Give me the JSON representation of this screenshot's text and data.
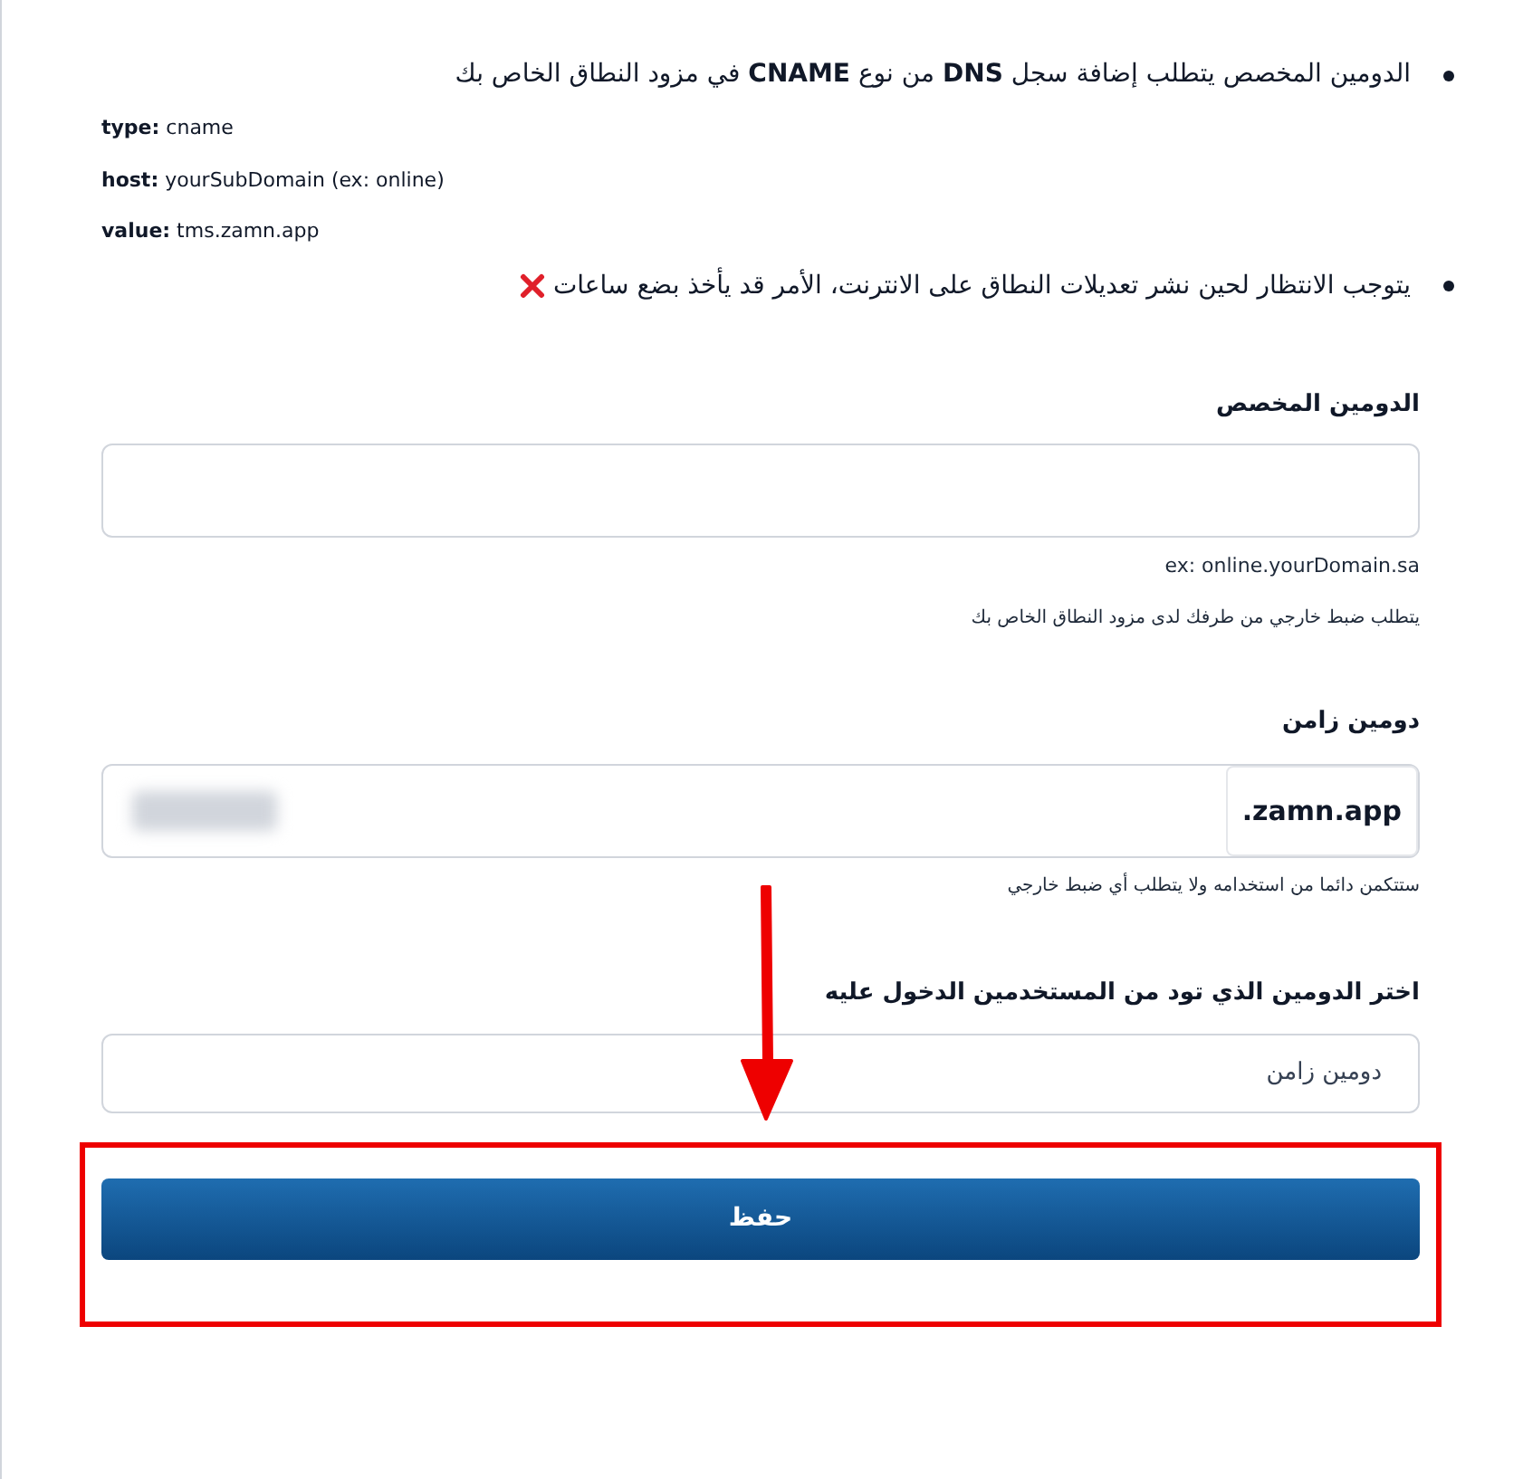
{
  "notes": [
    {
      "kind": "bullet",
      "text": "الدومين المخصص يتطلب إضافة سجل **DNS** من نوع **CNAME** في مزود النطاق الخاص بك"
    },
    {
      "kind": "record",
      "text": "**type:** cname"
    },
    {
      "kind": "record",
      "text": "**host:** yourSubDomain (ex: online)"
    },
    {
      "kind": "record",
      "text": "**value:** tms.zamn.app"
    },
    {
      "kind": "bullet_cross",
      "text": "يتوجب الانتظار لحين نشر تعديلات النطاق على الانترنت، الأمر قد يأخذ بضع ساعات"
    }
  ],
  "custom_domain": {
    "label": "الدومين المخصص",
    "example": "ex: online.yourDomain.sa",
    "hint": "يتطلب ضبط خارجي من طرفك لدى مزود النطاق الخاص بك"
  },
  "zamn_domain": {
    "label": "دومين زامن",
    "suffix": ".zamn.app",
    "hint": "ستتكمن دائما من استخدامه ولا يتطلب أي ضبط خارجي"
  },
  "choice": {
    "label": "اختر الدومين الذي تود من المستخدمين الدخول عليه",
    "value": "دومين زامن"
  },
  "save_button": {
    "label": "حفظ"
  }
}
